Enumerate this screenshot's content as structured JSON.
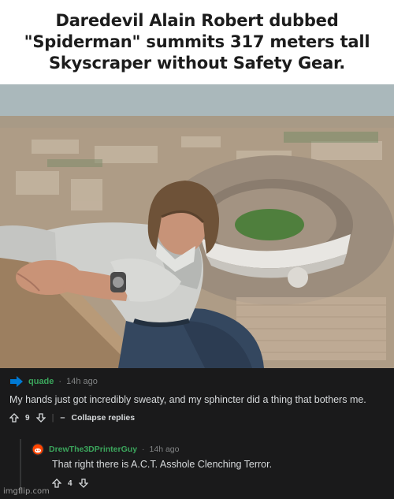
{
  "headline": "Daredevil Alain Robert dubbed \"Spiderman\" summits 317 meters tall Skyscraper without Safety Gear.",
  "comment": {
    "username": "quade",
    "separator": "·",
    "time": "14h ago",
    "text": "My hands just got incredibly sweaty, and my sphincter did a thing that bothers me.",
    "score": "9",
    "divider": "|",
    "collapse_label": "Collapse replies"
  },
  "reply": {
    "username": "DrewThe3DPrinterGuy",
    "separator": "·",
    "time": "14h ago",
    "text": "That right there is A.C.T. Asshole Clenching Terror.",
    "score": "4"
  },
  "watermark": "imgflip.com",
  "colors": {
    "background": "#1a1a1b",
    "username_green": "#3ba55c",
    "upvote_blue": "#0079d3",
    "text": "#d7dadc",
    "meta": "#818384"
  },
  "icons": {
    "op_avatar": "blue-arrow-icon",
    "upvote": "upvote-arrow-icon",
    "downvote": "downvote-arrow-icon",
    "collapse": "dash-icon",
    "reply_avatar": "reddit-snoo-icon"
  }
}
